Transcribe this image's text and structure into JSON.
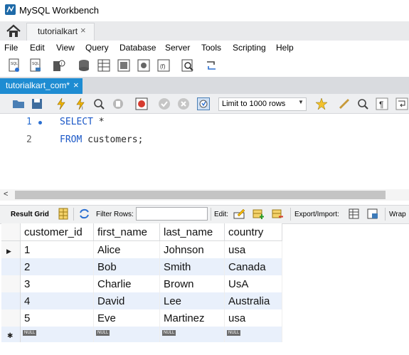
{
  "window": {
    "title": "MySQL Workbench"
  },
  "connection_tab": {
    "label": "tutorialkart",
    "close": "×"
  },
  "menu": [
    "File",
    "Edit",
    "View",
    "Query",
    "Database",
    "Server",
    "Tools",
    "Scripting",
    "Help"
  ],
  "query_tab": {
    "label": "tutorialkart_com*",
    "close": "×"
  },
  "sql_toolbar": {
    "limit_value": "Limit to 1000 rows"
  },
  "editor": {
    "lines": [
      {
        "number": "1",
        "keyword": "SELECT",
        "rest": " *"
      },
      {
        "number": "2",
        "keyword": "FROM",
        "rest": " customers;"
      }
    ]
  },
  "result_toolbar": {
    "result_grid": "Result Grid",
    "filter_rows": "Filter Rows:",
    "filter_value": "",
    "edit": "Edit:",
    "export_import": "Export/Import:",
    "wrap": "Wrap"
  },
  "result": {
    "columns": [
      "customer_id",
      "first_name",
      "last_name",
      "country"
    ],
    "rows": [
      [
        "1",
        "Alice",
        "Johnson",
        "usa"
      ],
      [
        "2",
        "Bob",
        "Smith",
        "Canada"
      ],
      [
        "3",
        "Charlie",
        "Brown",
        "UsA"
      ],
      [
        "4",
        "David",
        "Lee",
        "Australia"
      ],
      [
        "5",
        "Eve",
        "Martinez",
        "usa"
      ]
    ],
    "null_label": "NULL"
  },
  "colors": {
    "tab_active": "#1e8cd2",
    "keyword": "#1b58c7",
    "alt_row": "#e9f0fb"
  }
}
